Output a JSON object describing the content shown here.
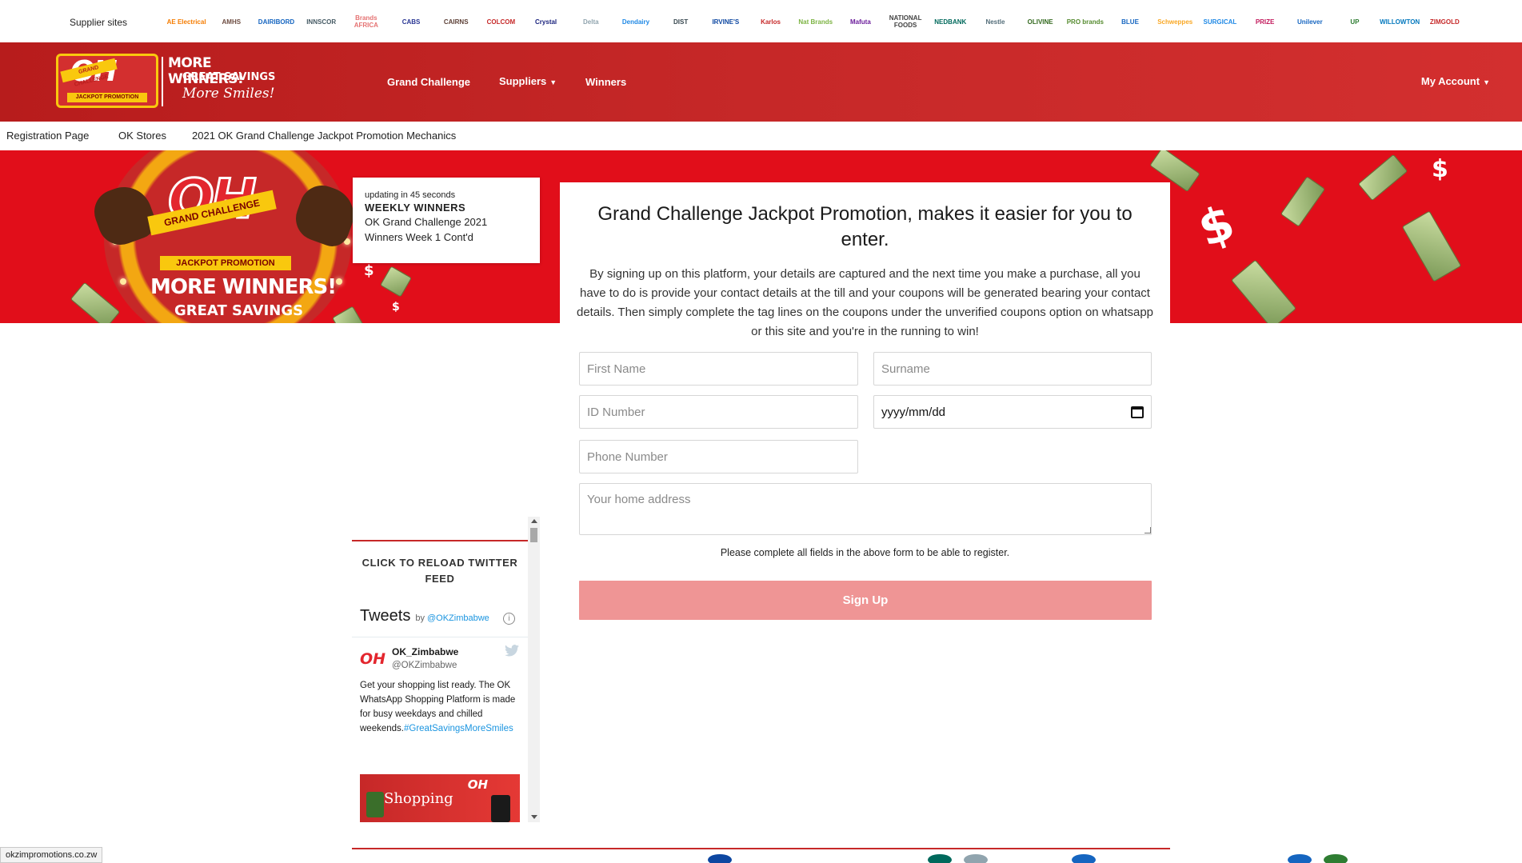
{
  "supplier_bar": {
    "label": "Supplier sites",
    "logos": [
      {
        "name": "ai-logo",
        "text": "AE Electrical",
        "color": "#f57c00"
      },
      {
        "name": "crest-logo",
        "text": "AMHS",
        "color": "#6d4c41"
      },
      {
        "name": "dairibord-logo",
        "text": "DAIRIBORD",
        "color": "#1565c0"
      },
      {
        "name": "innscor-logo",
        "text": "INNSCOR",
        "color": "#455a64"
      },
      {
        "name": "brands-africa-logo",
        "text": "Brands AFRICA",
        "color": "#e57373"
      },
      {
        "name": "cabs-logo",
        "text": "CABS",
        "color": "#283593"
      },
      {
        "name": "cairns-logo",
        "text": "CAIRNS",
        "color": "#5d4037"
      },
      {
        "name": "colcom-logo",
        "text": "COLCOM",
        "color": "#c62828"
      },
      {
        "name": "crystal-logo",
        "text": "Crystal",
        "color": "#1a237e"
      },
      {
        "name": "delta-logo",
        "text": "Delta",
        "color": "#90a4ae"
      },
      {
        "name": "dendairy-logo",
        "text": "Dendairy",
        "color": "#1e88e5"
      },
      {
        "name": "dist-logo",
        "text": "DIST",
        "color": "#37474f"
      },
      {
        "name": "irvines-logo",
        "text": "IRVINE'S",
        "color": "#0d47a1"
      },
      {
        "name": "karlos-logo",
        "text": "Karlos",
        "color": "#c62828"
      },
      {
        "name": "nat-brands-logo",
        "text": "Nat Brands",
        "color": "#7cb342"
      },
      {
        "name": "mafuta-logo",
        "text": "Mafuta",
        "color": "#6a1b9a"
      },
      {
        "name": "national-foods-logo",
        "text": "NATIONAL FOODS",
        "color": "#424242"
      },
      {
        "name": "nedbank-logo",
        "text": "NEDBANK",
        "color": "#00695c"
      },
      {
        "name": "nestle-logo",
        "text": "Nestle",
        "color": "#546e7a"
      },
      {
        "name": "olivine-logo",
        "text": "OLIVINE",
        "color": "#33691e"
      },
      {
        "name": "pro-brands-logo",
        "text": "PRO brands",
        "color": "#558b2f"
      },
      {
        "name": "blue-ribbon-logo",
        "text": "BLUE",
        "color": "#1565c0"
      },
      {
        "name": "schweppes-logo",
        "text": "Schweppes",
        "color": "#f9a825"
      },
      {
        "name": "surgical-logo",
        "text": "SURGICAL",
        "color": "#1e88e5"
      },
      {
        "name": "prize-logo",
        "text": "PRIZE",
        "color": "#c2185b"
      },
      {
        "name": "unilever-logo",
        "text": "Unilever",
        "color": "#1565c0"
      },
      {
        "name": "up-logo",
        "text": "UP",
        "color": "#2e7d32"
      },
      {
        "name": "willowton-logo",
        "text": "WILLOWTON",
        "color": "#0277bd"
      },
      {
        "name": "zimgold-logo",
        "text": "ZIMGOLD",
        "color": "#c62828"
      }
    ]
  },
  "brand": {
    "oh": "OH",
    "ribbon": "GRAND CHALLENGE",
    "strip": "JACKPOT PROMOTION",
    "line1": "MORE WINNERS!",
    "line2": "GREAT SAVINGS",
    "line3": "More Smiles!"
  },
  "nav": {
    "grand_challenge": "Grand Challenge",
    "suppliers": "Suppliers",
    "winners": "Winners",
    "account": "My Account",
    "caret": "▼"
  },
  "breadcrumbs": [
    "Registration Page",
    "OK Stores",
    "2021 OK Grand Challenge Jackpot Promotion Mechanics"
  ],
  "hero": {
    "oh": "OH",
    "ribbon": "GRAND CHALLENGE",
    "jackpot": "JACKPOT PROMOTION",
    "more_winners": "MORE WINNERS!",
    "great_savings": "GREAT SAVINGS",
    "dollar": "$"
  },
  "winners_card": {
    "update": "updating in 45 seconds",
    "title": "WEEKLY WINNERS",
    "line1": "OK Grand Challenge 2021",
    "line2": "Winners Week 1 Cont'd"
  },
  "form": {
    "title": "Grand Challenge Jackpot Promotion, makes it easier for you to enter.",
    "description": "By signing up on this platform, your details are captured and the next time you make a purchase, all you have to do is provide your contact details at the till and your coupons will be generated bearing your contact details. Then simply complete the tag lines on the coupons under the unverified coupons option on whatsapp or this site and you're in the running to win!",
    "first_name_placeholder": "First Name",
    "surname_placeholder": "Surname",
    "id_placeholder": "ID Number",
    "date_value": "yyyy/mm/dd",
    "phone_placeholder": "Phone Number",
    "address_placeholder": "Your home address",
    "note": "Please complete all fields in the above form to be able to register.",
    "signup_label": "Sign Up"
  },
  "twitter": {
    "reload": "CLICK TO RELOAD TWITTER FEED",
    "tweets_label": "Tweets",
    "by": "by",
    "handle_link": "@OKZimbabwe",
    "info": "i",
    "avatar": "OH",
    "author_name": "OK_Zimbabwe",
    "author_handle": "@OKZimbabwe",
    "tweet_text": "Get your shopping list ready. The OK WhatsApp Shopping Platform is made for busy weekdays and chilled weekends.",
    "tweet_tag": "#GreatSavingsMoreSmiles",
    "image_word": "Shopping",
    "image_oh": "OH"
  },
  "status_url": "okzimpromotions.co.zw",
  "colors": {
    "brand_red": "#c62828",
    "hero_red": "#e10e1a",
    "signup_disabled": "#ef9595",
    "gold": "#f9c80e",
    "link_blue": "#1b95e0"
  }
}
